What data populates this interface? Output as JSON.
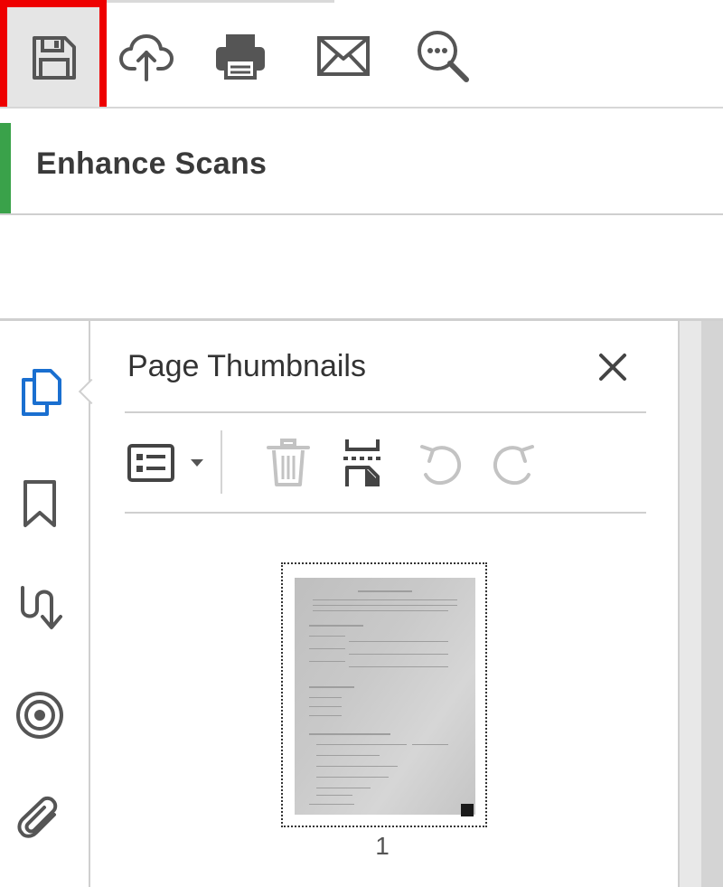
{
  "toolbar": {
    "buttons": [
      {
        "id": "save",
        "icon": "floppy-disk-icon",
        "highlighted": true
      },
      {
        "id": "upload",
        "icon": "cloud-upload-icon"
      },
      {
        "id": "print",
        "icon": "printer-icon"
      },
      {
        "id": "email",
        "icon": "envelope-icon"
      },
      {
        "id": "find",
        "icon": "search-icon"
      }
    ],
    "highlight_color": "#ee0000"
  },
  "tool": {
    "name": "Enhance Scans",
    "accent_color": "#3aa24a"
  },
  "left_rail": {
    "items": [
      {
        "icon": "page-thumbnails-icon",
        "active": true,
        "color": "#1a6fd0"
      },
      {
        "icon": "bookmark-icon"
      },
      {
        "icon": "tag-order-icon"
      },
      {
        "icon": "layers-icon"
      },
      {
        "icon": "attachment-icon"
      }
    ]
  },
  "panel": {
    "title": "Page Thumbnails",
    "toolbar": [
      {
        "icon": "options-icon",
        "has_dropdown": true
      },
      {
        "icon": "trash-icon",
        "disabled": true
      },
      {
        "icon": "insert-page-icon"
      },
      {
        "icon": "rotate-left-icon",
        "disabled": true
      },
      {
        "icon": "rotate-right-icon",
        "disabled": true
      }
    ],
    "thumbnails": [
      {
        "page_number": "1",
        "selected": true
      }
    ]
  }
}
